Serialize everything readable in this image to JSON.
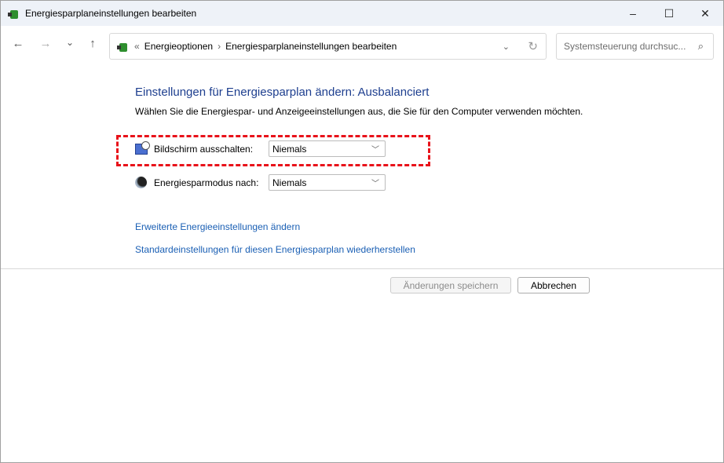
{
  "window": {
    "title": "Energiesparplaneinstellungen bearbeiten",
    "minimize": "–",
    "maximize": "☐",
    "close": "✕"
  },
  "nav": {
    "back": "←",
    "forward": "→",
    "recent": "⌄",
    "up": "↑"
  },
  "address": {
    "overflow": "«",
    "crumbs": [
      "Energieoptionen",
      "Energiesparplaneinstellungen bearbeiten"
    ],
    "separator": "›",
    "dropdown": "⌄",
    "refresh": "↻"
  },
  "search": {
    "placeholder": "Systemsteuerung durchsuc...",
    "icon": "⌕"
  },
  "main": {
    "heading": "Einstellungen für Energiesparplan ändern: Ausbalanciert",
    "subtitle": "Wählen Sie die Energiespar- und Anzeigeeinstellungen aus, die Sie für den Computer verwenden möchten.",
    "settings": [
      {
        "label": "Bildschirm ausschalten:",
        "value": "Niemals",
        "icon": "monitor-clock-icon"
      },
      {
        "label": "Energiesparmodus nach:",
        "value": "Niemals",
        "icon": "moon-icon"
      }
    ],
    "links": [
      "Erweiterte Energieeinstellungen ändern",
      "Standardeinstellungen für diesen Energiesparplan wiederherstellen"
    ],
    "save": "Änderungen speichern",
    "cancel": "Abbrechen"
  },
  "colors": {
    "heading": "#1e3f8f",
    "link": "#1a5fb4",
    "highlight": "#e8121a"
  }
}
